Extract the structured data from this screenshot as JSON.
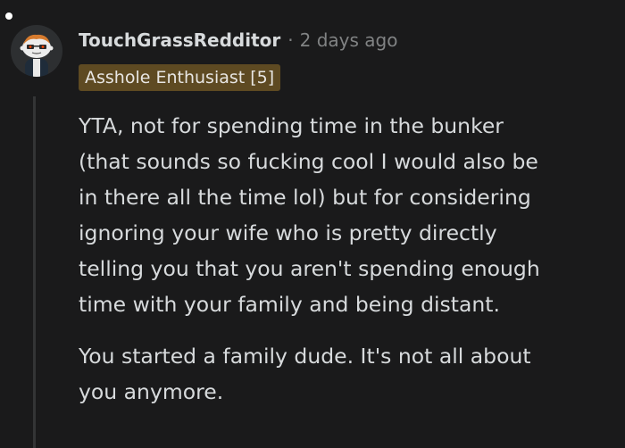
{
  "comment": {
    "username": "TouchGrassRedditor",
    "separator": "·",
    "timestamp": "2 days ago",
    "flair": "Asshole Enthusiast [5]",
    "avatar_icon": "snoo-avatar-icon",
    "paragraphs": [
      "YTA, not for spending time in the bunker\n(that sounds so fucking cool I would also be\nin there all the time lol) but for considering\nignoring your wife who is pretty directly\ntelling you that you aren't spending enough\ntime with your family and being distant.",
      "You started a family dude. It's not all about\nyou anymore."
    ]
  },
  "colors": {
    "background": "#1a1a1b",
    "text": "#d7dadc",
    "muted": "#818384",
    "flair_bg": "#5e4a22",
    "thread_line": "#343536"
  }
}
